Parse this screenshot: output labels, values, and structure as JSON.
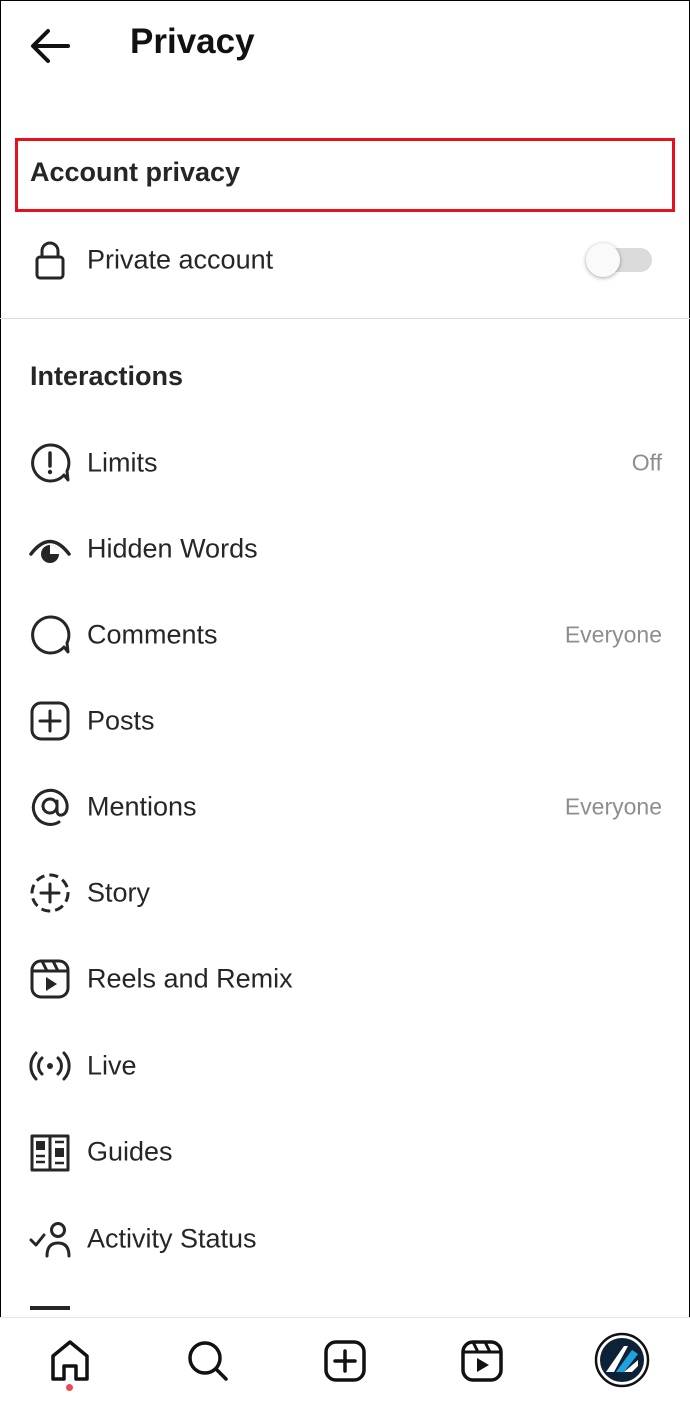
{
  "header": {
    "title": "Privacy",
    "back_icon": "arrow-left-icon"
  },
  "account_privacy": {
    "heading": "Account privacy",
    "private_account": {
      "label": "Private account",
      "icon": "lock-icon",
      "enabled": false
    }
  },
  "interactions": {
    "heading": "Interactions",
    "items": [
      {
        "label": "Limits",
        "value": "Off",
        "icon": "limits-icon"
      },
      {
        "label": "Hidden Words",
        "value": "",
        "icon": "hidden-words-icon"
      },
      {
        "label": "Comments",
        "value": "Everyone",
        "icon": "comment-icon"
      },
      {
        "label": "Posts",
        "value": "",
        "icon": "add-post-icon"
      },
      {
        "label": "Mentions",
        "value": "Everyone",
        "icon": "mention-icon"
      },
      {
        "label": "Story",
        "value": "",
        "icon": "story-icon"
      },
      {
        "label": "Reels and Remix",
        "value": "",
        "icon": "reels-icon"
      },
      {
        "label": "Live",
        "value": "",
        "icon": "live-icon"
      },
      {
        "label": "Guides",
        "value": "",
        "icon": "guides-icon"
      },
      {
        "label": "Activity Status",
        "value": "",
        "icon": "activity-status-icon"
      }
    ]
  },
  "bottom_nav": {
    "items": [
      "home-icon",
      "search-icon",
      "create-icon",
      "reels-icon",
      "profile-avatar"
    ],
    "notification_dot_color": "#ed4956"
  },
  "colors": {
    "highlight_border": "#e8101a",
    "secondary_text": "#8e8e8e",
    "toggle_track": "#dbdbdb"
  }
}
